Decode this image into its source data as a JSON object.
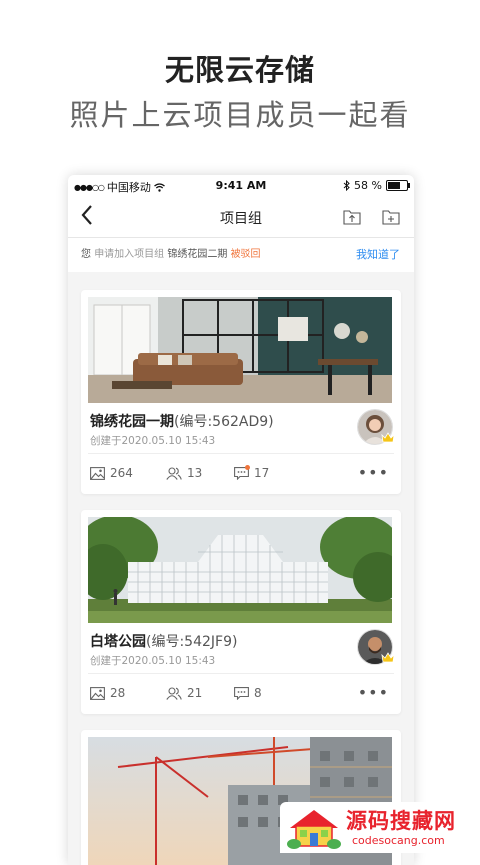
{
  "promo": {
    "title": "无限云存储",
    "subtitle": "照片上云项目成员一起看"
  },
  "status_bar": {
    "carrier": "中国移动",
    "time": "9:41 AM",
    "battery": "58 %",
    "battery_level": 0.58
  },
  "nav": {
    "title": "项目组",
    "back_icon": "chevron-left-icon",
    "upload_icon": "folder-upload-icon",
    "add_icon": "folder-add-icon"
  },
  "notice": {
    "prefix": "您",
    "request_text": "申请加入项目组",
    "project_name": "锦绣花园二期",
    "status": "被驳回",
    "action": "我知道了"
  },
  "projects": [
    {
      "name": "锦绣花园一期",
      "code": "(编号:562AD9)",
      "created": "创建于2020.05.10  15:43",
      "photos": "264",
      "members": "13",
      "comments": "17",
      "has_new_comment": true
    },
    {
      "name": "白塔公园",
      "code": "(编号:542JF9)",
      "created": "创建于2020.05.10  15:43",
      "photos": "28",
      "members": "21",
      "comments": "8",
      "has_new_comment": false
    },
    {
      "name": "",
      "code": "",
      "created": ""
    }
  ],
  "more_label": "•••",
  "watermark": {
    "main": "源码搜藏网",
    "sub": "codesocang.com"
  },
  "colors": {
    "accent_blue": "#2d8cf0",
    "alert_orange": "#f0753c",
    "badge_gold": "#f5c518",
    "watermark_red": "#e8232d"
  }
}
